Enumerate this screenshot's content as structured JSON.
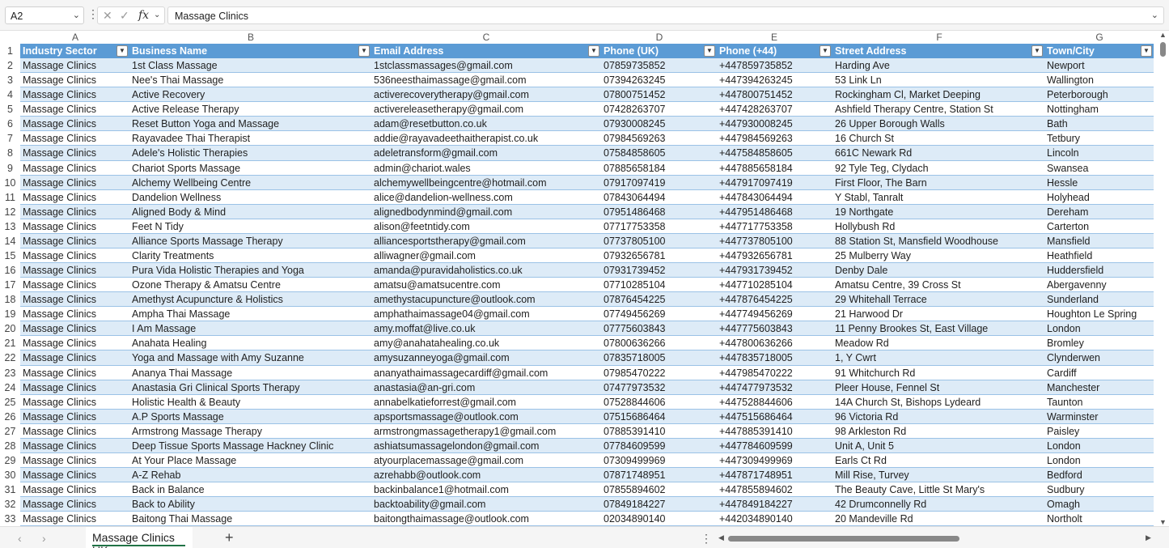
{
  "namebox": {
    "value": "A2"
  },
  "formula": {
    "value": "Massage Clinics",
    "fx": "fx"
  },
  "columns": [
    "A",
    "B",
    "C",
    "D",
    "E",
    "F",
    "G"
  ],
  "headers": [
    "Industry Sector",
    "Business Name",
    "Email Address",
    "Phone (UK)",
    "Phone (+44)",
    "Street Address",
    "Town/City"
  ],
  "row_numbers": [
    "1",
    "2",
    "3",
    "4",
    "5",
    "6",
    "7",
    "8",
    "9",
    "10",
    "11",
    "12",
    "13",
    "14",
    "15",
    "16",
    "17",
    "18",
    "19",
    "20",
    "21",
    "22",
    "23",
    "24",
    "25",
    "26",
    "27",
    "28",
    "29",
    "30",
    "31",
    "32",
    "33"
  ],
  "rows": [
    [
      "Massage Clinics",
      "1st Class Massage",
      "1stclassmassages@gmail.com",
      "07859735852",
      "+447859735852",
      "Harding Ave",
      "Newport"
    ],
    [
      "Massage Clinics",
      "Nee's Thai Massage",
      "536neesthaimassage@gmail.com",
      "07394263245",
      "+447394263245",
      "53 Link Ln",
      "Wallington"
    ],
    [
      "Massage Clinics",
      "Active Recovery",
      "activerecoverytherapy@gmail.com",
      "07800751452",
      "+447800751452",
      "Rockingham Cl, Market Deeping",
      "Peterborough"
    ],
    [
      "Massage Clinics",
      "Active Release Therapy",
      "activereleasetherapy@gmail.com",
      "07428263707",
      "+447428263707",
      "Ashfield Therapy Centre, Station St",
      "Nottingham"
    ],
    [
      "Massage Clinics",
      "Reset Button Yoga and Massage",
      "adam@resetbutton.co.uk",
      "07930008245",
      "+447930008245",
      "26 Upper Borough Walls",
      "Bath"
    ],
    [
      "Massage Clinics",
      "Rayavadee Thai Therapist",
      "addie@rayavadeethaitherapist.co.uk",
      "07984569263",
      "+447984569263",
      "16 Church St",
      "Tetbury"
    ],
    [
      "Massage Clinics",
      "Adele's Holistic Therapies",
      "adeletransform@gmail.com",
      "07584858605",
      "+447584858605",
      "661C Newark Rd",
      "Lincoln"
    ],
    [
      "Massage Clinics",
      "Chariot Sports Massage",
      "admin@chariot.wales",
      "07885658184",
      "+447885658184",
      "92 Tyle Teg, Clydach",
      "Swansea"
    ],
    [
      "Massage Clinics",
      "Alchemy Wellbeing Centre",
      "alchemywellbeingcentre@hotmail.com",
      "07917097419",
      "+447917097419",
      "First Floor, The Barn",
      "Hessle"
    ],
    [
      "Massage Clinics",
      "Dandelion Wellness",
      "alice@dandelion-wellness.com",
      "07843064494",
      "+447843064494",
      "Y Stabl, Tanralt",
      "Holyhead"
    ],
    [
      "Massage Clinics",
      "Aligned Body & Mind",
      "alignedbodynmind@gmail.com",
      "07951486468",
      "+447951486468",
      "19 Northgate",
      "Dereham"
    ],
    [
      "Massage Clinics",
      "Feet N Tidy",
      "alison@feetntidy.com",
      "07717753358",
      "+447717753358",
      "Hollybush Rd",
      "Carterton"
    ],
    [
      "Massage Clinics",
      "Alliance Sports Massage Therapy",
      "alliancesportstherapy@gmail.com",
      "07737805100",
      "+447737805100",
      "88 Station St, Mansfield Woodhouse",
      "Mansfield"
    ],
    [
      "Massage Clinics",
      "Clarity Treatments",
      "alliwagner@gmail.com",
      "07932656781",
      "+447932656781",
      "25 Mulberry Way",
      "Heathfield"
    ],
    [
      "Massage Clinics",
      "Pura Vida Holistic Therapies and Yoga",
      "amanda@puravidaholistics.co.uk",
      "07931739452",
      "+447931739452",
      "Denby Dale",
      "Huddersfield"
    ],
    [
      "Massage Clinics",
      "Ozone Therapy & Amatsu Centre",
      "amatsu@amatsucentre.com",
      "07710285104",
      "+447710285104",
      "Amatsu Centre, 39 Cross St",
      "Abergavenny"
    ],
    [
      "Massage Clinics",
      "Amethyst Acupuncture & Holistics",
      "amethystacupuncture@outlook.com",
      "07876454225",
      "+447876454225",
      "29 Whitehall Terrace",
      "Sunderland"
    ],
    [
      "Massage Clinics",
      "Ampha Thai Massage",
      "amphathaimassage04@gmail.com",
      "07749456269",
      "+447749456269",
      "21 Harwood Dr",
      "Houghton Le Spring"
    ],
    [
      "Massage Clinics",
      "I Am Massage",
      "amy.moffat@live.co.uk",
      "07775603843",
      "+447775603843",
      "11 Penny Brookes St, East Village",
      "London"
    ],
    [
      "Massage Clinics",
      "Anahata Healing",
      "amy@anahatahealing.co.uk",
      "07800636266",
      "+447800636266",
      "Meadow Rd",
      "Bromley"
    ],
    [
      "Massage Clinics",
      "Yoga and Massage with Amy Suzanne",
      "amysuzanneyoga@gmail.com",
      "07835718005",
      "+447835718005",
      "1, Y Cwrt",
      "Clynderwen"
    ],
    [
      "Massage Clinics",
      "Ananya Thai Massage",
      "ananyathaimassagecardiff@gmail.com",
      "07985470222",
      "+447985470222",
      "91 Whitchurch Rd",
      "Cardiff"
    ],
    [
      "Massage Clinics",
      "Anastasia Gri Clinical Sports Therapy",
      "anastasia@an-gri.com",
      "07477973532",
      "+447477973532",
      "Pleer House, Fennel St",
      "Manchester"
    ],
    [
      "Massage Clinics",
      "Holistic Health & Beauty",
      "annabelkatieforrest@gmail.com",
      "07528844606",
      "+447528844606",
      "14A Church St, Bishops Lydeard",
      "Taunton"
    ],
    [
      "Massage Clinics",
      "A.P Sports Massage",
      "apsportsmassage@outlook.com",
      "07515686464",
      "+447515686464",
      "96 Victoria Rd",
      "Warminster"
    ],
    [
      "Massage Clinics",
      "Armstrong Massage Therapy",
      "armstrongmassagetherapy1@gmail.com",
      "07885391410",
      "+447885391410",
      "98 Arkleston Rd",
      "Paisley"
    ],
    [
      "Massage Clinics",
      "Deep Tissue Sports Massage Hackney Clinic",
      "ashiatsumassagelondon@gmail.com",
      "07784609599",
      "+447784609599",
      "Unit A, Unit 5",
      "London"
    ],
    [
      "Massage Clinics",
      "At Your Place Massage",
      "atyourplacemassage@gmail.com",
      "07309499969",
      "+447309499969",
      "Earls Ct Rd",
      "London"
    ],
    [
      "Massage Clinics",
      "A-Z Rehab",
      "azrehabb@outlook.com",
      "07871748951",
      "+447871748951",
      "Mill Rise, Turvey",
      "Bedford"
    ],
    [
      "Massage Clinics",
      "Back in Balance",
      "backinbalance1@hotmail.com",
      "07855894602",
      "+447855894602",
      "The Beauty Cave, Little St Mary's",
      "Sudbury"
    ],
    [
      "Massage Clinics",
      "Back to Ability",
      "backtoability@gmail.com",
      "07849184227",
      "+447849184227",
      "42 Drumconnelly Rd",
      "Omagh"
    ],
    [
      "Massage Clinics",
      "Baitong Thai Massage",
      "baitongthaimassage@outlook.com",
      "02034890140",
      "+442034890140",
      "20 Mandeville Rd",
      "Northolt"
    ]
  ],
  "sheet_tab": {
    "label": "Massage Clinics UK"
  },
  "colors": {
    "header_bg": "#5b9bd5",
    "band": "#ddebf7",
    "accent": "#217346"
  }
}
